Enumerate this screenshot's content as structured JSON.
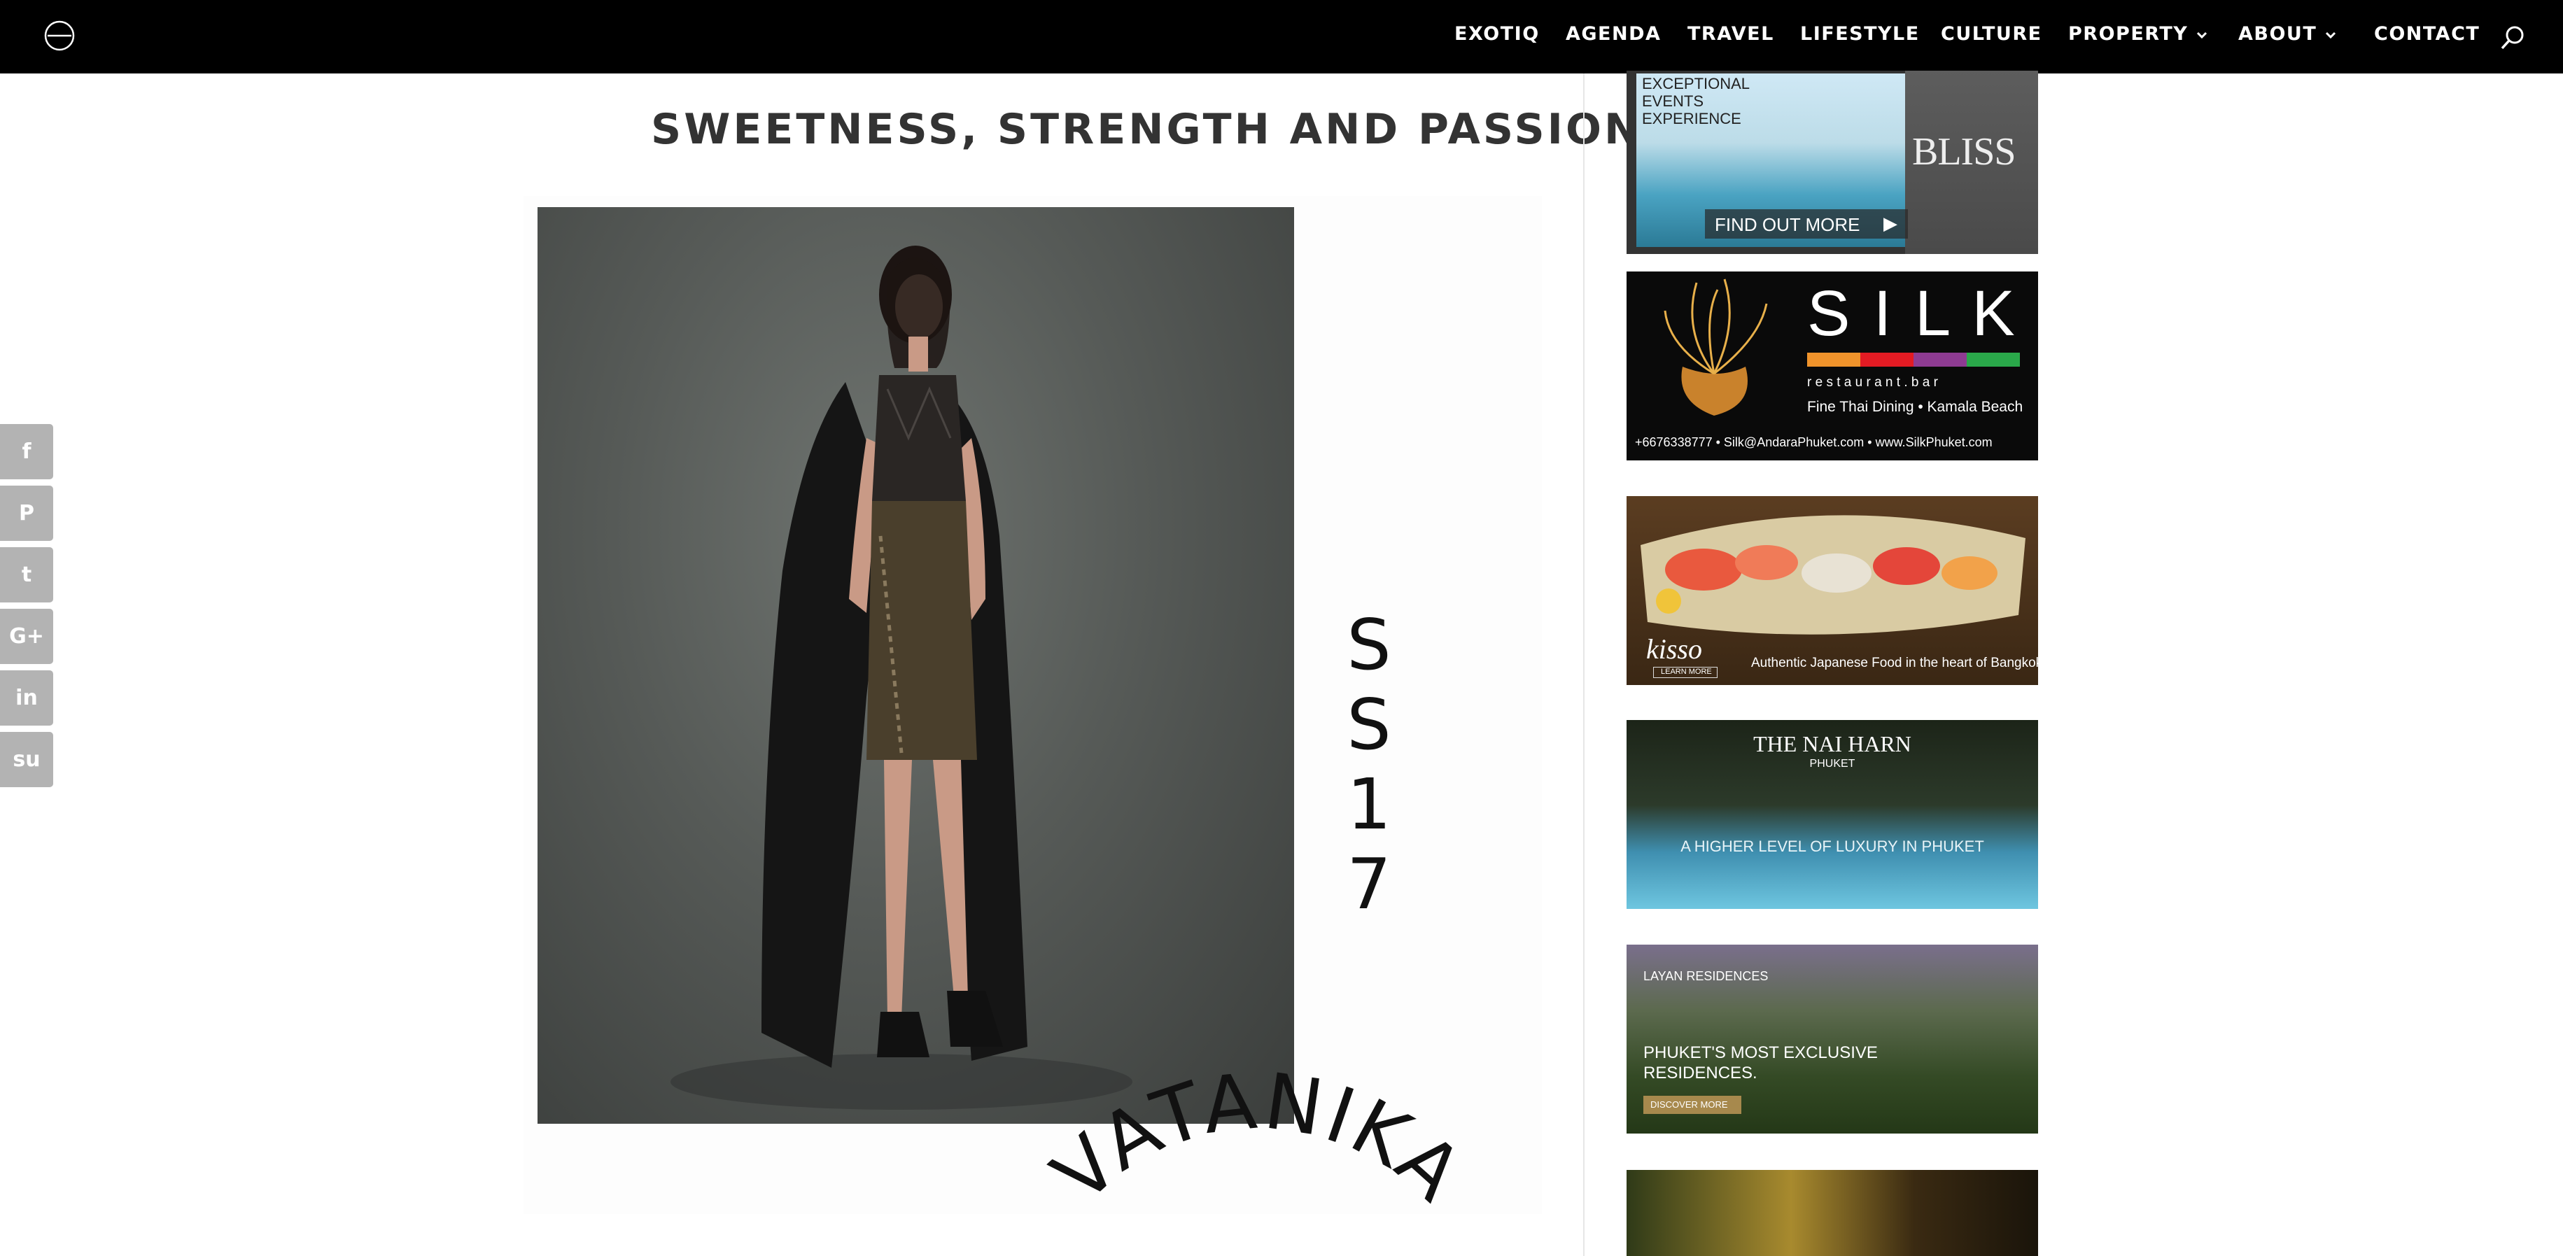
{
  "nav": {
    "items": [
      {
        "label": "EXOTIQ"
      },
      {
        "label": "AGENDA"
      },
      {
        "label": "TRAVEL"
      },
      {
        "label": "LIFESTYLE"
      },
      {
        "label": "CULTURE"
      },
      {
        "label": "PROPERTY"
      },
      {
        "label": "ABOUT"
      },
      {
        "label": "CONTACT"
      }
    ]
  },
  "social": [
    {
      "glyph": "f"
    },
    {
      "glyph": "P"
    },
    {
      "glyph": "t"
    },
    {
      "glyph": "G+"
    },
    {
      "glyph": "in"
    },
    {
      "glyph": "su"
    }
  ],
  "article": {
    "title": "SWEETNESS, STRENGTH AND PASSION",
    "season_chars": [
      "S",
      "S",
      "1",
      "7"
    ],
    "brand": "VATANIKA"
  },
  "ads": {
    "bliss": {
      "headline": [
        "EXCEPTIONAL",
        "EVENTS",
        "EXPERIENCE"
      ],
      "cta": "FIND OUT MORE",
      "brand": "BLISS"
    },
    "silk": {
      "brand": "S I L K",
      "sub": "r e s t a u r a n t . b a r",
      "tagline": "Fine Thai Dining • Kamala Beach",
      "contact": "+6676338777 • Silk@AndaraPhuket.com • www.SilkPhuket.com",
      "stripe_colors": [
        "#f0932b",
        "#e31b23",
        "#8e3b92",
        "#2aa84a"
      ]
    },
    "kisso": {
      "brand": "kisso",
      "cta": "LEARN MORE",
      "tagline": "Authentic Japanese Food in the heart of Bangkok"
    },
    "naiharn": {
      "brand": "THE NAI HARN",
      "sub": "PHUKET",
      "tagline": "A HIGHER LEVEL OF LUXURY IN PHUKET"
    },
    "layan": {
      "brand": "LAYAN RESIDENCES",
      "headline": [
        "PHUKET'S MOST EXCLUSIVE",
        "RESIDENCES."
      ],
      "cta": "DISCOVER MORE"
    }
  }
}
